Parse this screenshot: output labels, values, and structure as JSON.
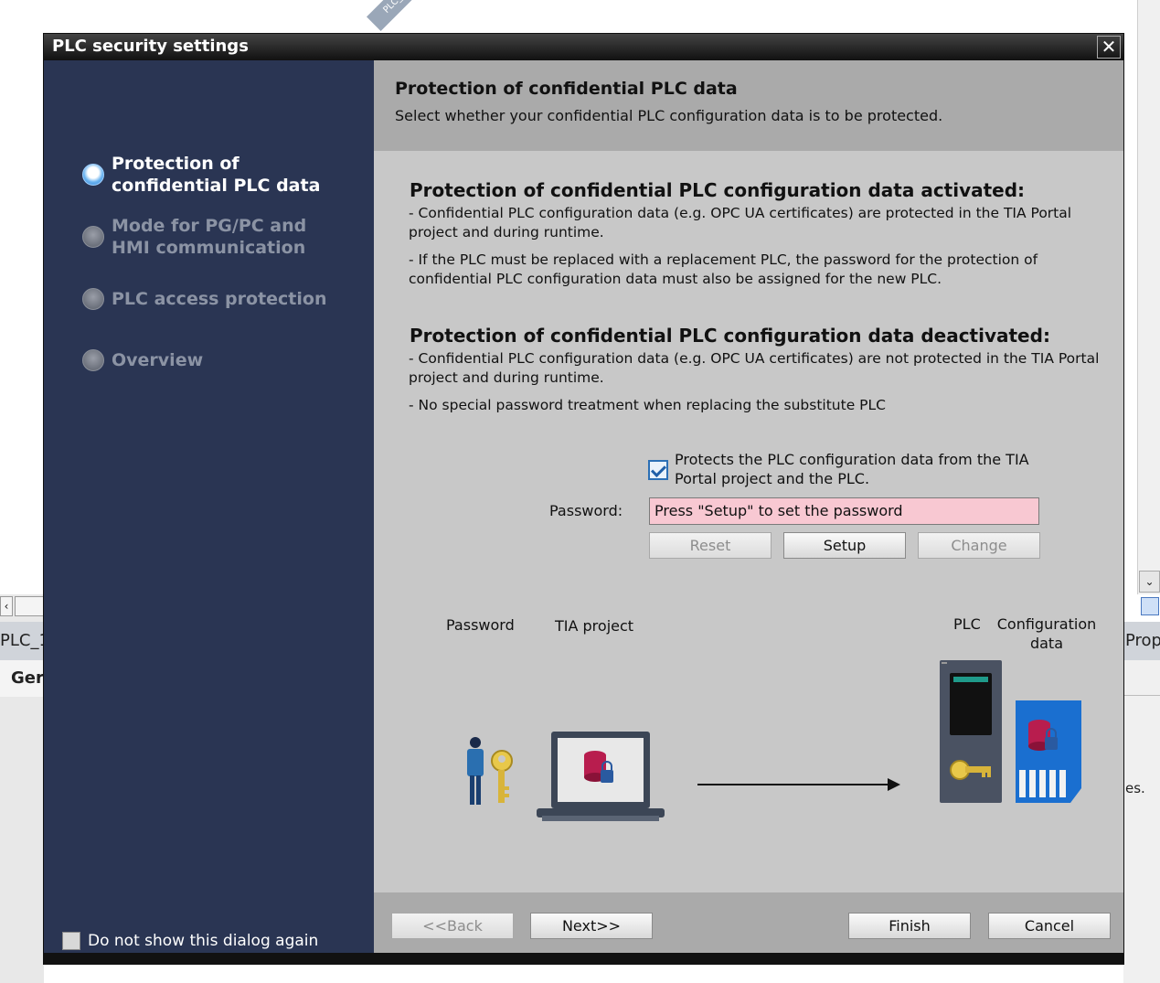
{
  "background": {
    "tag_text": "PLC_",
    "left_tab_symbol": "‹",
    "left_title": "PLC_1",
    "left_tab": "Ger",
    "right_title": "Prop",
    "right_text": "es.",
    "scroll_down_symbol": "⌄"
  },
  "dialog": {
    "title": "PLC security settings",
    "close_symbol": "✕"
  },
  "sidebar": {
    "steps": [
      {
        "label": "Protection of confidential PLC data",
        "active": true
      },
      {
        "label": "Mode for PG/PC and HMI communication",
        "active": false
      },
      {
        "label": "PLC access protection",
        "active": false
      },
      {
        "label": "Overview",
        "active": false
      }
    ],
    "dont_show_label": "Do not show this dialog again",
    "dont_show_checked": false
  },
  "content": {
    "header_title": "Protection of confidential PLC data",
    "header_subtitle": "Select whether your confidential PLC configuration data is to be protected.",
    "activated": {
      "title": "Protection of confidential PLC configuration data activated:",
      "line1": "- Confidential PLC configuration data (e.g. OPC UA certificates) are protected in the TIA Portal project and during runtime.",
      "line2": "- If the PLC must be replaced with a replacement PLC, the password for the protection of confidential PLC configuration data must also be assigned for the new PLC."
    },
    "deactivated": {
      "title": "Protection of confidential PLC configuration data deactivated:",
      "line1": "- Confidential PLC configuration data (e.g. OPC UA certificates) are not protected in the TIA Portal project and during runtime.",
      "line2": "- No special password treatment when replacing the substitute PLC"
    },
    "protect_checkbox": {
      "label": "Protects the PLC configuration data from the TIA Portal project and the PLC.",
      "checked": true
    },
    "password": {
      "label": "Password:",
      "value": "Press \"Setup\" to set the password"
    },
    "buttons": {
      "reset": "Reset",
      "setup": "Setup",
      "change": "Change"
    },
    "diagram": {
      "password_label": "Password",
      "tia_label": "TIA project",
      "plc_label": "PLC",
      "config_label": "Configuration data"
    }
  },
  "footer": {
    "back": "<<Back",
    "next": "Next>>",
    "finish": "Finish",
    "cancel": "Cancel"
  },
  "colors": {
    "sidebar_bg": "#2a3553",
    "content_bg": "#c8c8c8",
    "header_bg": "#aaaaaa",
    "password_field_bg": "#f8c8d2"
  }
}
